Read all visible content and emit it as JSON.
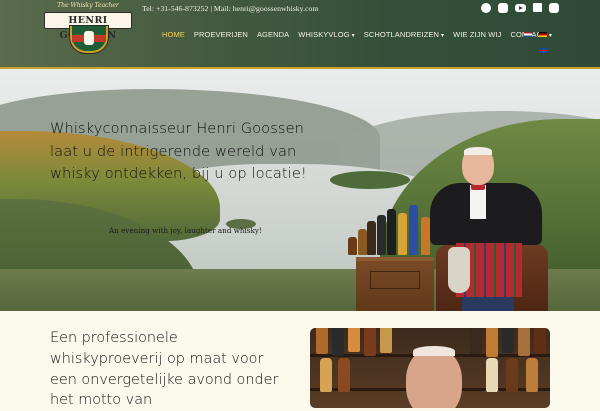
{
  "logo": {
    "tagline": "The Whisky Teacher",
    "name": "HENRI GOOSSEN"
  },
  "header": {
    "contact": "Tel: +31-546-873252 | Mail: henri@goossenwhisky.com",
    "social_icons": [
      "facebook-icon",
      "instagram-icon",
      "youtube-icon",
      "linkedin-icon",
      "mastodon-icon"
    ]
  },
  "nav": {
    "items": [
      {
        "label": "HOME",
        "active": true,
        "dropdown": false
      },
      {
        "label": "PROEVERIJEN",
        "active": false,
        "dropdown": false
      },
      {
        "label": "AGENDA",
        "active": false,
        "dropdown": false
      },
      {
        "label": "WHISKYVLOG",
        "active": false,
        "dropdown": true
      },
      {
        "label": "SCHOTLANDREIZEN",
        "active": false,
        "dropdown": true
      },
      {
        "label": "WIE ZIJN WIJ",
        "active": false,
        "dropdown": false
      },
      {
        "label": "CONTACT",
        "active": false,
        "dropdown": true
      }
    ],
    "languages": [
      "nl",
      "de",
      "en"
    ]
  },
  "hero": {
    "title": "Whiskyconnaisseur Henri Goossen laat u de intrigerende wereld van whisky ontdekken, bij u op locatie!",
    "subtitle": "An evening with joy, laughter and whisky!"
  },
  "section2": {
    "title": "Een professionele whiskyproeverij op maat voor een onvergetelijke avond onder het motto van"
  },
  "colors": {
    "header_bg": "#34503a",
    "accent_gold": "#c9a227",
    "active_nav": "#f1cf5b",
    "page_bg": "#fbf8ec"
  }
}
